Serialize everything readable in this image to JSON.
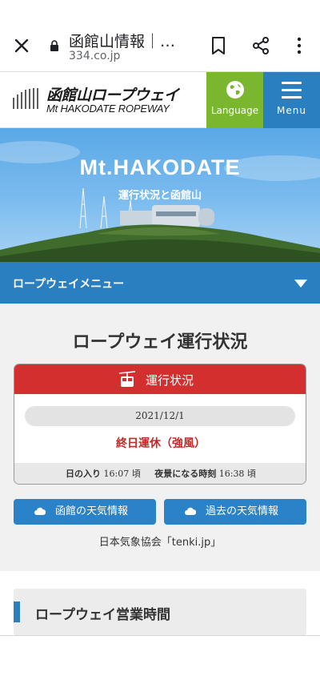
{
  "browser": {
    "title": "函館山情報｜…",
    "url": "334.co.jp",
    "icons": [
      "close-icon",
      "lock-icon",
      "bookmark-icon",
      "share-icon",
      "more-icon"
    ]
  },
  "header": {
    "logo_jp": "函館山ロープウェイ",
    "logo_en": "Mt HAKODATE ROPEWAY",
    "language_label": "Language",
    "menu_label": "Menu",
    "colors": {
      "language_bg": "#7ab72e",
      "menu_bg": "#2a7fc0"
    }
  },
  "hero": {
    "title": "Mt.HAKODATE",
    "subtitle": "運行状況と函館山"
  },
  "ropeway_menu": {
    "label": "ロープウェイメニュー"
  },
  "status": {
    "section_title": "ロープウェイ運行状況",
    "card_title": "運行状況",
    "date": "2021/12/1",
    "state": "終日運休（強風）",
    "sunset_label": "日の入り",
    "sunset_value": "16:07 頃",
    "night_label": "夜景になる時刻",
    "night_value": "16:38 頃",
    "colors": {
      "header_bg": "#d32f2f",
      "state_text": "#c62828"
    }
  },
  "weather": {
    "hakodate_button": "函館の天気情報",
    "past_button": "過去の天気情報",
    "credit": "日本気象協会「tenki.jp」"
  },
  "hours": {
    "title": "ロープウェイ営業時間"
  }
}
